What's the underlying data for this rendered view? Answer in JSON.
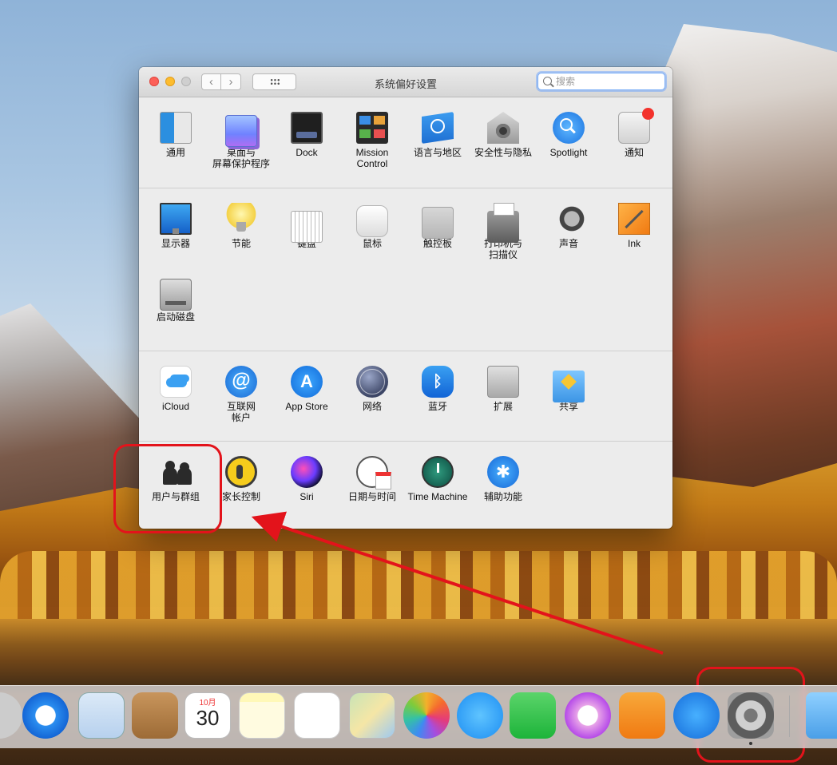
{
  "window": {
    "title": "系统偏好设置",
    "search_placeholder": "搜索",
    "nav_back": "‹",
    "nav_forward": "›"
  },
  "sections": [
    [
      {
        "id": "general",
        "label": "通用",
        "icon": "general-icon"
      },
      {
        "id": "desktop",
        "label": "桌面与\n屏幕保护程序",
        "icon": "desktop-screensaver-icon"
      },
      {
        "id": "dock",
        "label": "Dock",
        "icon": "dock-icon"
      },
      {
        "id": "mission",
        "label": "Mission\nControl",
        "icon": "mission-control-icon"
      },
      {
        "id": "language",
        "label": "语言与地区",
        "icon": "language-region-icon"
      },
      {
        "id": "security",
        "label": "安全性与隐私",
        "icon": "security-privacy-icon"
      },
      {
        "id": "spotlight",
        "label": "Spotlight",
        "icon": "spotlight-icon"
      },
      {
        "id": "notifications",
        "label": "通知",
        "icon": "notifications-icon"
      }
    ],
    [
      {
        "id": "displays",
        "label": "显示器",
        "icon": "display-icon"
      },
      {
        "id": "energy",
        "label": "节能",
        "icon": "energy-saver-icon"
      },
      {
        "id": "keyboard",
        "label": "键盘",
        "icon": "keyboard-icon"
      },
      {
        "id": "mouse",
        "label": "鼠标",
        "icon": "mouse-icon"
      },
      {
        "id": "trackpad",
        "label": "触控板",
        "icon": "trackpad-icon"
      },
      {
        "id": "printers",
        "label": "打印机与\n扫描仪",
        "icon": "printer-icon"
      },
      {
        "id": "sound",
        "label": "声音",
        "icon": "sound-icon"
      },
      {
        "id": "ink",
        "label": "Ink",
        "icon": "ink-icon"
      },
      {
        "id": "startup",
        "label": "启动磁盘",
        "icon": "startup-disk-icon"
      }
    ],
    [
      {
        "id": "icloud",
        "label": "iCloud",
        "icon": "icloud-icon"
      },
      {
        "id": "internet",
        "label": "互联网\n帐户",
        "icon": "internet-accounts-icon",
        "glyph": "@"
      },
      {
        "id": "appstore",
        "label": "App Store",
        "icon": "app-store-icon",
        "glyph": "A"
      },
      {
        "id": "network",
        "label": "网络",
        "icon": "network-icon"
      },
      {
        "id": "bluetooth",
        "label": "蓝牙",
        "icon": "bluetooth-icon",
        "glyph": "ᛒ"
      },
      {
        "id": "extensions",
        "label": "扩展",
        "icon": "extensions-icon"
      },
      {
        "id": "sharing",
        "label": "共享",
        "icon": "sharing-icon"
      }
    ],
    [
      {
        "id": "users",
        "label": "用户与群组",
        "icon": "users-groups-icon"
      },
      {
        "id": "parental",
        "label": "家长控制",
        "icon": "parental-controls-icon"
      },
      {
        "id": "siri",
        "label": "Siri",
        "icon": "siri-icon"
      },
      {
        "id": "datetime",
        "label": "日期与时间",
        "icon": "date-time-icon"
      },
      {
        "id": "timemachine",
        "label": "Time Machine",
        "icon": "time-machine-icon"
      },
      {
        "id": "accessibility",
        "label": "辅助功能",
        "icon": "accessibility-icon",
        "glyph": "✱"
      }
    ]
  ],
  "dock": {
    "calendar_month": "10月",
    "calendar_day": "30",
    "items": [
      "finder",
      "safari",
      "mail",
      "contacts",
      "calendar",
      "notes",
      "reminders",
      "maps",
      "photos",
      "messages",
      "facetime",
      "itunes",
      "ibooks",
      "app-store",
      "system-preferences",
      "downloads"
    ]
  },
  "annotation": {
    "color": "#e3131b"
  }
}
